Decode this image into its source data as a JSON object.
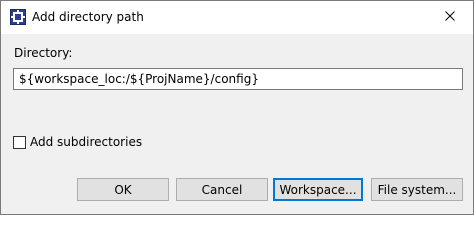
{
  "window": {
    "title": "Add directory path",
    "icon": "eclipse-cdt-icon",
    "close_icon": "close-icon"
  },
  "directory": {
    "label": "Directory:",
    "value": "${workspace_loc:/${ProjName}/config}"
  },
  "subdirectories": {
    "label": "Add subdirectories",
    "checked": false
  },
  "buttons": {
    "ok": "OK",
    "cancel": "Cancel",
    "workspace": "Workspace...",
    "filesystem": "File system..."
  },
  "colors": {
    "focus_accent": "#0078d7",
    "client_background": "#f0f0f0"
  }
}
